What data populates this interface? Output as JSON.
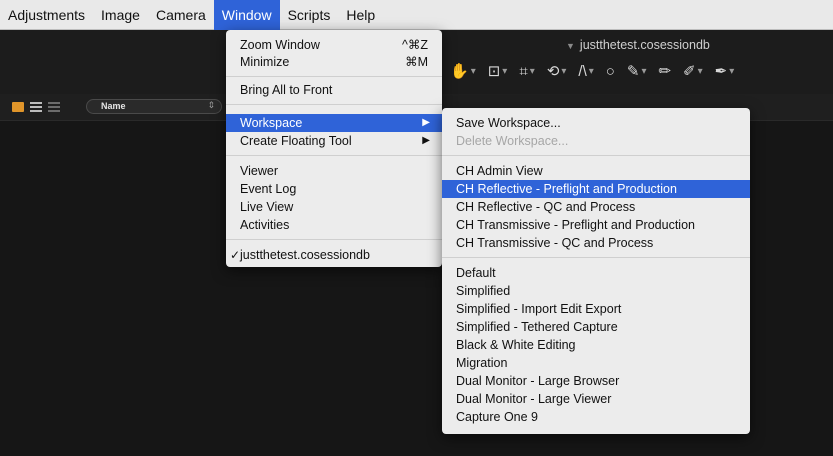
{
  "menubar": {
    "items": [
      "Adjustments",
      "Image",
      "Camera",
      "Window",
      "Scripts",
      "Help"
    ],
    "active": "Window"
  },
  "document": {
    "title": "justthetest.cosessiondb"
  },
  "browser": {
    "sort_label": "Name"
  },
  "window_menu": {
    "zoom_window": "Zoom Window",
    "zoom_window_shortcut": "^⌘Z",
    "minimize": "Minimize",
    "minimize_shortcut": "⌘M",
    "bring_all": "Bring All to Front",
    "workspace": "Workspace",
    "create_floating_tool": "Create Floating Tool",
    "viewer": "Viewer",
    "event_log": "Event Log",
    "live_view": "Live View",
    "activities": "Activities",
    "session": "justthetest.cosessiondb"
  },
  "workspace_menu": {
    "save": "Save Workspace...",
    "delete": "Delete Workspace...",
    "ch_admin": "CH Admin View",
    "ch_reflective_preflight": "CH Reflective - Preflight and Production",
    "ch_reflective_qc": "CH Reflective - QC and Process",
    "ch_transmissive_preflight": "CH Transmissive - Preflight and Production",
    "ch_transmissive_qc": "CH Transmissive - QC and Process",
    "default": "Default",
    "simplified": "Simplified",
    "simplified_import": "Simplified - Import Edit Export",
    "simplified_tethered": "Simplified - Tethered Capture",
    "bw_editing": "Black & White Editing",
    "migration": "Migration",
    "dual_browser": "Dual Monitor - Large Browser",
    "dual_viewer": "Dual Monitor - Large Viewer",
    "capture_one_9": "Capture One 9"
  },
  "colors": {
    "highlight": "#2f63d8",
    "background": "#161616",
    "accent": "#f0a020"
  }
}
